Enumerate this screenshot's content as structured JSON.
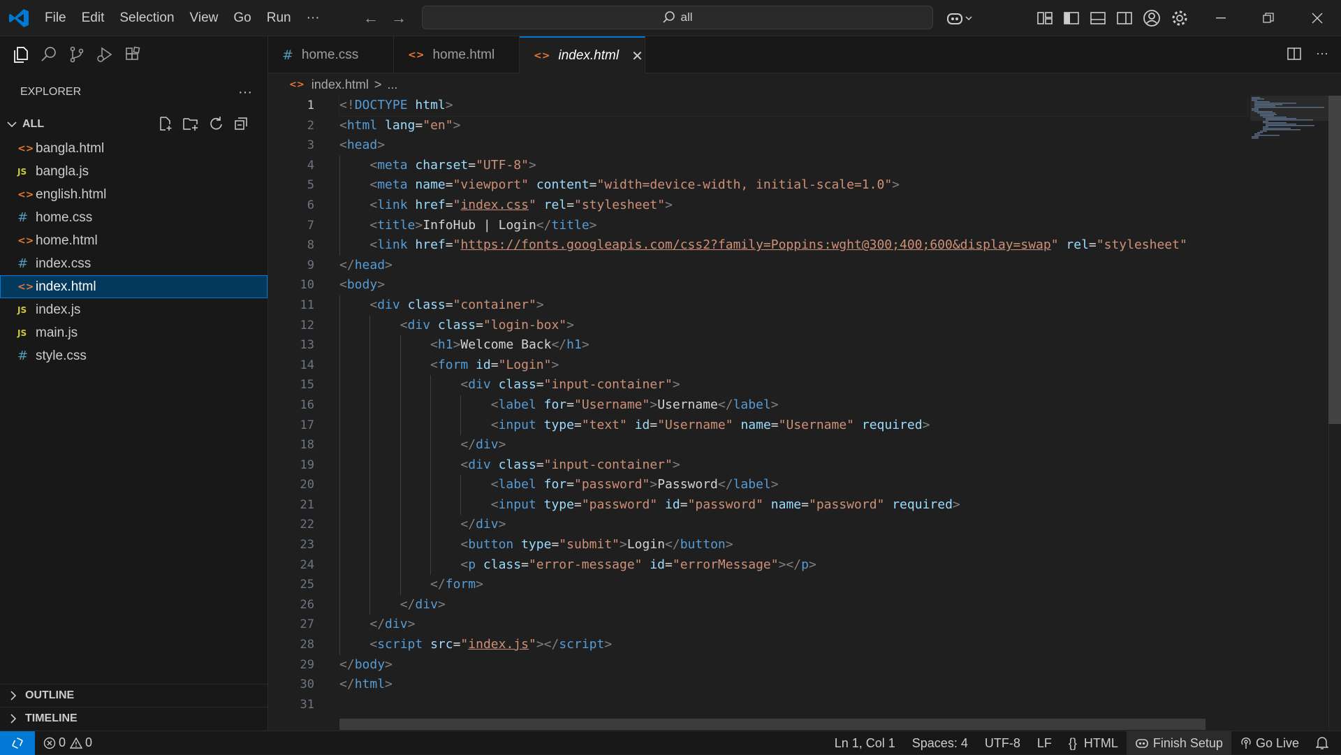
{
  "menu": [
    "File",
    "Edit",
    "Selection",
    "View",
    "Go",
    "Run",
    "···"
  ],
  "search": {
    "text": "all"
  },
  "explorer": {
    "title": "EXPLORER",
    "more": "···",
    "folder": "ALL"
  },
  "files": [
    {
      "name": "bangla.html",
      "type": "html"
    },
    {
      "name": "bangla.js",
      "type": "js"
    },
    {
      "name": "english.html",
      "type": "html"
    },
    {
      "name": "home.css",
      "type": "css"
    },
    {
      "name": "home.html",
      "type": "html"
    },
    {
      "name": "index.css",
      "type": "css"
    },
    {
      "name": "index.html",
      "type": "html",
      "active": true
    },
    {
      "name": "index.js",
      "type": "js"
    },
    {
      "name": "main.js",
      "type": "js"
    },
    {
      "name": "style.css",
      "type": "css"
    }
  ],
  "sections": {
    "outline": "OUTLINE",
    "timeline": "TIMELINE"
  },
  "tabs": [
    {
      "label": "home.css",
      "icon": "#"
    },
    {
      "label": "home.html",
      "icon": "<>"
    },
    {
      "label": "index.html",
      "icon": "<>",
      "active": true
    }
  ],
  "breadcrumb": {
    "file": "index.html",
    "sep": ">",
    "rest": "..."
  },
  "icon_glyphs": {
    "html": "<>",
    "js": "JS",
    "css": "#"
  },
  "code_lines": [
    [
      [
        "b",
        "<!"
      ],
      [
        "g",
        "DOCTYPE "
      ],
      [
        "a",
        "html"
      ],
      [
        "b",
        ">"
      ]
    ],
    [
      [
        "b",
        "<"
      ],
      [
        "g",
        "html "
      ],
      [
        "a",
        "lang"
      ],
      [
        "t",
        "="
      ],
      [
        "s",
        "\"en\""
      ],
      [
        "b",
        ">"
      ]
    ],
    [
      [
        "b",
        "<"
      ],
      [
        "g",
        "head"
      ],
      [
        "b",
        ">"
      ]
    ],
    [
      [
        "i",
        "    "
      ],
      [
        "b",
        "<"
      ],
      [
        "g",
        "meta "
      ],
      [
        "a",
        "charset"
      ],
      [
        "t",
        "="
      ],
      [
        "s",
        "\"UTF-8\""
      ],
      [
        "b",
        ">"
      ]
    ],
    [
      [
        "i",
        "    "
      ],
      [
        "b",
        "<"
      ],
      [
        "g",
        "meta "
      ],
      [
        "a",
        "name"
      ],
      [
        "t",
        "="
      ],
      [
        "s",
        "\"viewport\" "
      ],
      [
        "a",
        "content"
      ],
      [
        "t",
        "="
      ],
      [
        "s",
        "\"width=device-width, initial-scale=1.0\""
      ],
      [
        "b",
        ">"
      ]
    ],
    [
      [
        "i",
        "    "
      ],
      [
        "b",
        "<"
      ],
      [
        "g",
        "link "
      ],
      [
        "a",
        "href"
      ],
      [
        "t",
        "="
      ],
      [
        "s",
        "\""
      ],
      [
        "su",
        "index.css"
      ],
      [
        "s",
        "\" "
      ],
      [
        "a",
        "rel"
      ],
      [
        "t",
        "="
      ],
      [
        "s",
        "\"stylesheet\""
      ],
      [
        "b",
        ">"
      ]
    ],
    [
      [
        "i",
        "    "
      ],
      [
        "b",
        "<"
      ],
      [
        "g",
        "title"
      ],
      [
        "b",
        ">"
      ],
      [
        "t",
        "InfoHub | Login"
      ],
      [
        "b",
        "</"
      ],
      [
        "g",
        "title"
      ],
      [
        "b",
        ">"
      ]
    ],
    [
      [
        "i",
        "    "
      ],
      [
        "b",
        "<"
      ],
      [
        "g",
        "link "
      ],
      [
        "a",
        "href"
      ],
      [
        "t",
        "="
      ],
      [
        "s",
        "\""
      ],
      [
        "su",
        "https://fonts.googleapis.com/css2?family=Poppins:wght@300;400;600&display=swap"
      ],
      [
        "s",
        "\" "
      ],
      [
        "a",
        "rel"
      ],
      [
        "t",
        "="
      ],
      [
        "s",
        "\"stylesheet\""
      ]
    ],
    [
      [
        "b",
        "</"
      ],
      [
        "g",
        "head"
      ],
      [
        "b",
        ">"
      ]
    ],
    [
      [
        "b",
        "<"
      ],
      [
        "g",
        "body"
      ],
      [
        "b",
        ">"
      ]
    ],
    [
      [
        "i",
        "    "
      ],
      [
        "b",
        "<"
      ],
      [
        "g",
        "div "
      ],
      [
        "a",
        "class"
      ],
      [
        "t",
        "="
      ],
      [
        "s",
        "\"container\""
      ],
      [
        "b",
        ">"
      ]
    ],
    [
      [
        "i",
        "        "
      ],
      [
        "b",
        "<"
      ],
      [
        "g",
        "div "
      ],
      [
        "a",
        "class"
      ],
      [
        "t",
        "="
      ],
      [
        "s",
        "\"login-box\""
      ],
      [
        "b",
        ">"
      ]
    ],
    [
      [
        "i",
        "            "
      ],
      [
        "b",
        "<"
      ],
      [
        "g",
        "h1"
      ],
      [
        "b",
        ">"
      ],
      [
        "t",
        "Welcome Back"
      ],
      [
        "b",
        "</"
      ],
      [
        "g",
        "h1"
      ],
      [
        "b",
        ">"
      ]
    ],
    [
      [
        "i",
        "            "
      ],
      [
        "b",
        "<"
      ],
      [
        "g",
        "form "
      ],
      [
        "a",
        "id"
      ],
      [
        "t",
        "="
      ],
      [
        "s",
        "\"Login\""
      ],
      [
        "b",
        ">"
      ]
    ],
    [
      [
        "i",
        "                "
      ],
      [
        "b",
        "<"
      ],
      [
        "g",
        "div "
      ],
      [
        "a",
        "class"
      ],
      [
        "t",
        "="
      ],
      [
        "s",
        "\"input-container\""
      ],
      [
        "b",
        ">"
      ]
    ],
    [
      [
        "i",
        "                    "
      ],
      [
        "b",
        "<"
      ],
      [
        "g",
        "label "
      ],
      [
        "a",
        "for"
      ],
      [
        "t",
        "="
      ],
      [
        "s",
        "\"Username\""
      ],
      [
        "b",
        ">"
      ],
      [
        "t",
        "Username"
      ],
      [
        "b",
        "</"
      ],
      [
        "g",
        "label"
      ],
      [
        "b",
        ">"
      ]
    ],
    [
      [
        "i",
        "                    "
      ],
      [
        "b",
        "<"
      ],
      [
        "g",
        "input "
      ],
      [
        "a",
        "type"
      ],
      [
        "t",
        "="
      ],
      [
        "s",
        "\"text\" "
      ],
      [
        "a",
        "id"
      ],
      [
        "t",
        "="
      ],
      [
        "s",
        "\"Username\" "
      ],
      [
        "a",
        "name"
      ],
      [
        "t",
        "="
      ],
      [
        "s",
        "\"Username\" "
      ],
      [
        "a",
        "required"
      ],
      [
        "b",
        ">"
      ]
    ],
    [
      [
        "i",
        "                "
      ],
      [
        "b",
        "</"
      ],
      [
        "g",
        "div"
      ],
      [
        "b",
        ">"
      ]
    ],
    [
      [
        "i",
        "                "
      ],
      [
        "b",
        "<"
      ],
      [
        "g",
        "div "
      ],
      [
        "a",
        "class"
      ],
      [
        "t",
        "="
      ],
      [
        "s",
        "\"input-container\""
      ],
      [
        "b",
        ">"
      ]
    ],
    [
      [
        "i",
        "                    "
      ],
      [
        "b",
        "<"
      ],
      [
        "g",
        "label "
      ],
      [
        "a",
        "for"
      ],
      [
        "t",
        "="
      ],
      [
        "s",
        "\"password\""
      ],
      [
        "b",
        ">"
      ],
      [
        "t",
        "Password"
      ],
      [
        "b",
        "</"
      ],
      [
        "g",
        "label"
      ],
      [
        "b",
        ">"
      ]
    ],
    [
      [
        "i",
        "                    "
      ],
      [
        "b",
        "<"
      ],
      [
        "g",
        "input "
      ],
      [
        "a",
        "type"
      ],
      [
        "t",
        "="
      ],
      [
        "s",
        "\"password\" "
      ],
      [
        "a",
        "id"
      ],
      [
        "t",
        "="
      ],
      [
        "s",
        "\"password\" "
      ],
      [
        "a",
        "name"
      ],
      [
        "t",
        "="
      ],
      [
        "s",
        "\"password\" "
      ],
      [
        "a",
        "required"
      ],
      [
        "b",
        ">"
      ]
    ],
    [
      [
        "i",
        "                "
      ],
      [
        "b",
        "</"
      ],
      [
        "g",
        "div"
      ],
      [
        "b",
        ">"
      ]
    ],
    [
      [
        "i",
        "                "
      ],
      [
        "b",
        "<"
      ],
      [
        "g",
        "button "
      ],
      [
        "a",
        "type"
      ],
      [
        "t",
        "="
      ],
      [
        "s",
        "\"submit\""
      ],
      [
        "b",
        ">"
      ],
      [
        "t",
        "Login"
      ],
      [
        "b",
        "</"
      ],
      [
        "g",
        "button"
      ],
      [
        "b",
        ">"
      ]
    ],
    [
      [
        "i",
        "                "
      ],
      [
        "b",
        "<"
      ],
      [
        "g",
        "p "
      ],
      [
        "a",
        "class"
      ],
      [
        "t",
        "="
      ],
      [
        "s",
        "\"error-message\" "
      ],
      [
        "a",
        "id"
      ],
      [
        "t",
        "="
      ],
      [
        "s",
        "\"errorMessage\""
      ],
      [
        "b",
        "></"
      ],
      [
        "g",
        "p"
      ],
      [
        "b",
        ">"
      ]
    ],
    [
      [
        "i",
        "            "
      ],
      [
        "b",
        "</"
      ],
      [
        "g",
        "form"
      ],
      [
        "b",
        ">"
      ]
    ],
    [
      [
        "i",
        "        "
      ],
      [
        "b",
        "</"
      ],
      [
        "g",
        "div"
      ],
      [
        "b",
        ">"
      ]
    ],
    [
      [
        "i",
        "    "
      ],
      [
        "b",
        "</"
      ],
      [
        "g",
        "div"
      ],
      [
        "b",
        ">"
      ]
    ],
    [
      [
        "i",
        "    "
      ],
      [
        "b",
        "<"
      ],
      [
        "g",
        "script "
      ],
      [
        "a",
        "src"
      ],
      [
        "t",
        "="
      ],
      [
        "s",
        "\""
      ],
      [
        "su",
        "index.js"
      ],
      [
        "s",
        "\""
      ],
      [
        "b",
        "></"
      ],
      [
        "g",
        "script"
      ],
      [
        "b",
        ">"
      ]
    ],
    [
      [
        "b",
        "</"
      ],
      [
        "g",
        "body"
      ],
      [
        "b",
        ">"
      ]
    ],
    [
      [
        "b",
        "</"
      ],
      [
        "g",
        "html"
      ],
      [
        "b",
        ">"
      ]
    ],
    []
  ],
  "status": {
    "errors": "0",
    "warnings": "0",
    "position": "Ln 1, Col 1",
    "spaces": "Spaces: 4",
    "encoding": "UTF-8",
    "eol": "LF",
    "language_braces": "{}",
    "language": "HTML",
    "finish_setup": "Finish Setup",
    "go_live": "Go Live"
  },
  "colors": {
    "accent": "#0078d4",
    "selection": "#04395e",
    "tag": "#569cd6",
    "attribute": "#9cdcfe",
    "string": "#ce9178"
  }
}
